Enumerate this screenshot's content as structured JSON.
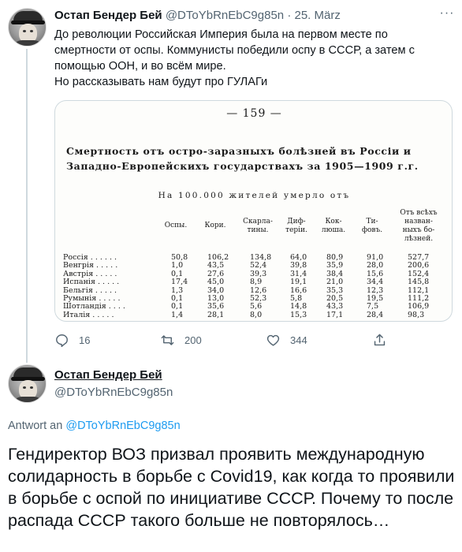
{
  "tweet1": {
    "author_name": "Остап Бендер Бей",
    "author_handle": "@DToYbRnEbC9g85n",
    "separator": "·",
    "date": "25. März",
    "more_icon": "more-horizontal-icon",
    "text_line1": "До революции Российская Империя была на первом месте по смертности от оспы. Коммунисты победили оспу в СССР, а затем с помощью ООН, и во всём мире.",
    "text_line2": "Но рассказывать нам будут про ГУЛАГи",
    "image": {
      "page_number": "— 159 —",
      "heading": "Смертность отъ остро-заразныхъ болѣзней въ Россіи и Западно-Европейскихъ государствахъ за 1905—1909 г.г.",
      "subheading": "На 100.000 жителей умерло отъ",
      "columns": [
        "Оспы.",
        "Кори.",
        "Скарла-\nтины.",
        "Диф-\nтеріи.",
        "Кок-\nлюша.",
        "Ти-\nфовъ.",
        "Отъ всѣхъ\nназван-\nныхъ бо-\nлѣзней."
      ],
      "rows": [
        [
          "Россія . . . . . .",
          "50,8",
          "106,2",
          "134,8",
          "64,0",
          "80,9",
          "91,0",
          "527,7"
        ],
        [
          "Венгрія . . . . .",
          "1,0",
          "43,5",
          "52,4",
          "39,8",
          "35,9",
          "28,0",
          "200,6"
        ],
        [
          "Австрія . . . . .",
          "0,1",
          "27,6",
          "39,3",
          "31,4",
          "38,4",
          "15,6",
          "152,4"
        ],
        [
          "Испанія . . . . .",
          "17,4",
          "45,0",
          "8,9",
          "19,1",
          "21,0",
          "34,4",
          "145,8"
        ],
        [
          "Бельгія . . . . .",
          "1,3",
          "34,0",
          "12,6",
          "16,6",
          "35,3",
          "12,3",
          "112,1"
        ],
        [
          "Румынія . . . . .",
          "0,1",
          "13,0",
          "52,3",
          "5,8",
          "20,5",
          "19,5",
          "111,2"
        ],
        [
          "Шотландія . . . .",
          "0,1",
          "35,6",
          "5,6",
          "14,8",
          "43,3",
          "7,5",
          "106,9"
        ],
        [
          "Италія . . . . .",
          "1,4",
          "28,1",
          "8,0",
          "15,3",
          "17,1",
          "28,4",
          "98,3"
        ]
      ]
    },
    "actions": {
      "reply_count": "16",
      "retweet_count": "200",
      "like_count": "344"
    }
  },
  "tweet2": {
    "author_name": "Остап Бендер Бей",
    "author_handle": "@DToYbRnEbC9g85n",
    "reply_prefix": "Antwort an",
    "reply_to": "@DToYbRnEbC9g85n",
    "text": "Гендиректор ВОЗ призвал проявить международную солидарность в борьбе с Covid19, как когда то проявили в борьбе с оспой по инициативе СССР. Почему то после распада СССР такого больше не повторялось…"
  }
}
